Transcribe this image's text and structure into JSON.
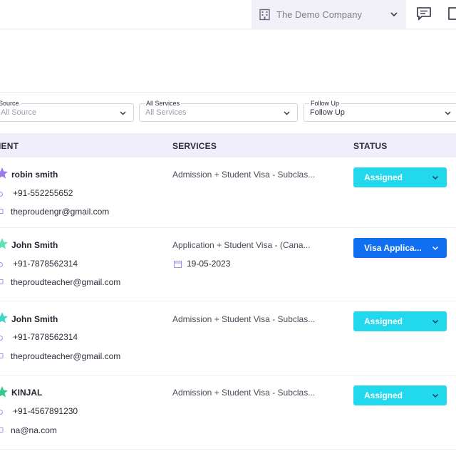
{
  "header": {
    "company_name": "The Demo Company",
    "icons": [
      "building-icon",
      "chevron-down-icon",
      "chat-icon",
      "window-icon"
    ],
    "company_bg": "#f1eff7"
  },
  "filters": [
    {
      "label": "Source",
      "value": "All Source"
    },
    {
      "label": "All Services",
      "value": "All Services"
    },
    {
      "label": "Follow Up",
      "value": "Follow Up"
    }
  ],
  "table": {
    "columns": [
      "IENT",
      "SERVICES",
      "STATUS"
    ],
    "rows": [
      {
        "name": "robin smith",
        "phone": "+91-552255652",
        "email": "theproudengr@gmail.com",
        "service": "Admission + Student Visa - Subclas...",
        "date": "",
        "status": "Assigned",
        "status_color": "#22d8ec",
        "star_color": "#9b7bf0"
      },
      {
        "name": "John Smith",
        "phone": "+91-7878562314",
        "email": "theproudteacher@gmail.com",
        "service": "Application + Student Visa - (Cana...",
        "date": "19-05-2023",
        "status": "Visa Applica...",
        "status_color": "#0f6ff0",
        "star_color": "#5fe0b5"
      },
      {
        "name": "John Smith",
        "phone": "+91-7878562314",
        "email": "theproudteacher@gmail.com",
        "service": "Admission + Student Visa - Subclas...",
        "date": "",
        "status": "Assigned",
        "status_color": "#22d8ec",
        "star_color": "#3fd6c7"
      },
      {
        "name": "KINJAL",
        "phone": "+91-4567891230",
        "email": "na@na.com",
        "service": "Admission + Student Visa - Subclas...",
        "date": "",
        "status": "Assigned",
        "status_color": "#22d8ec",
        "star_color": "#37c98a"
      }
    ]
  }
}
